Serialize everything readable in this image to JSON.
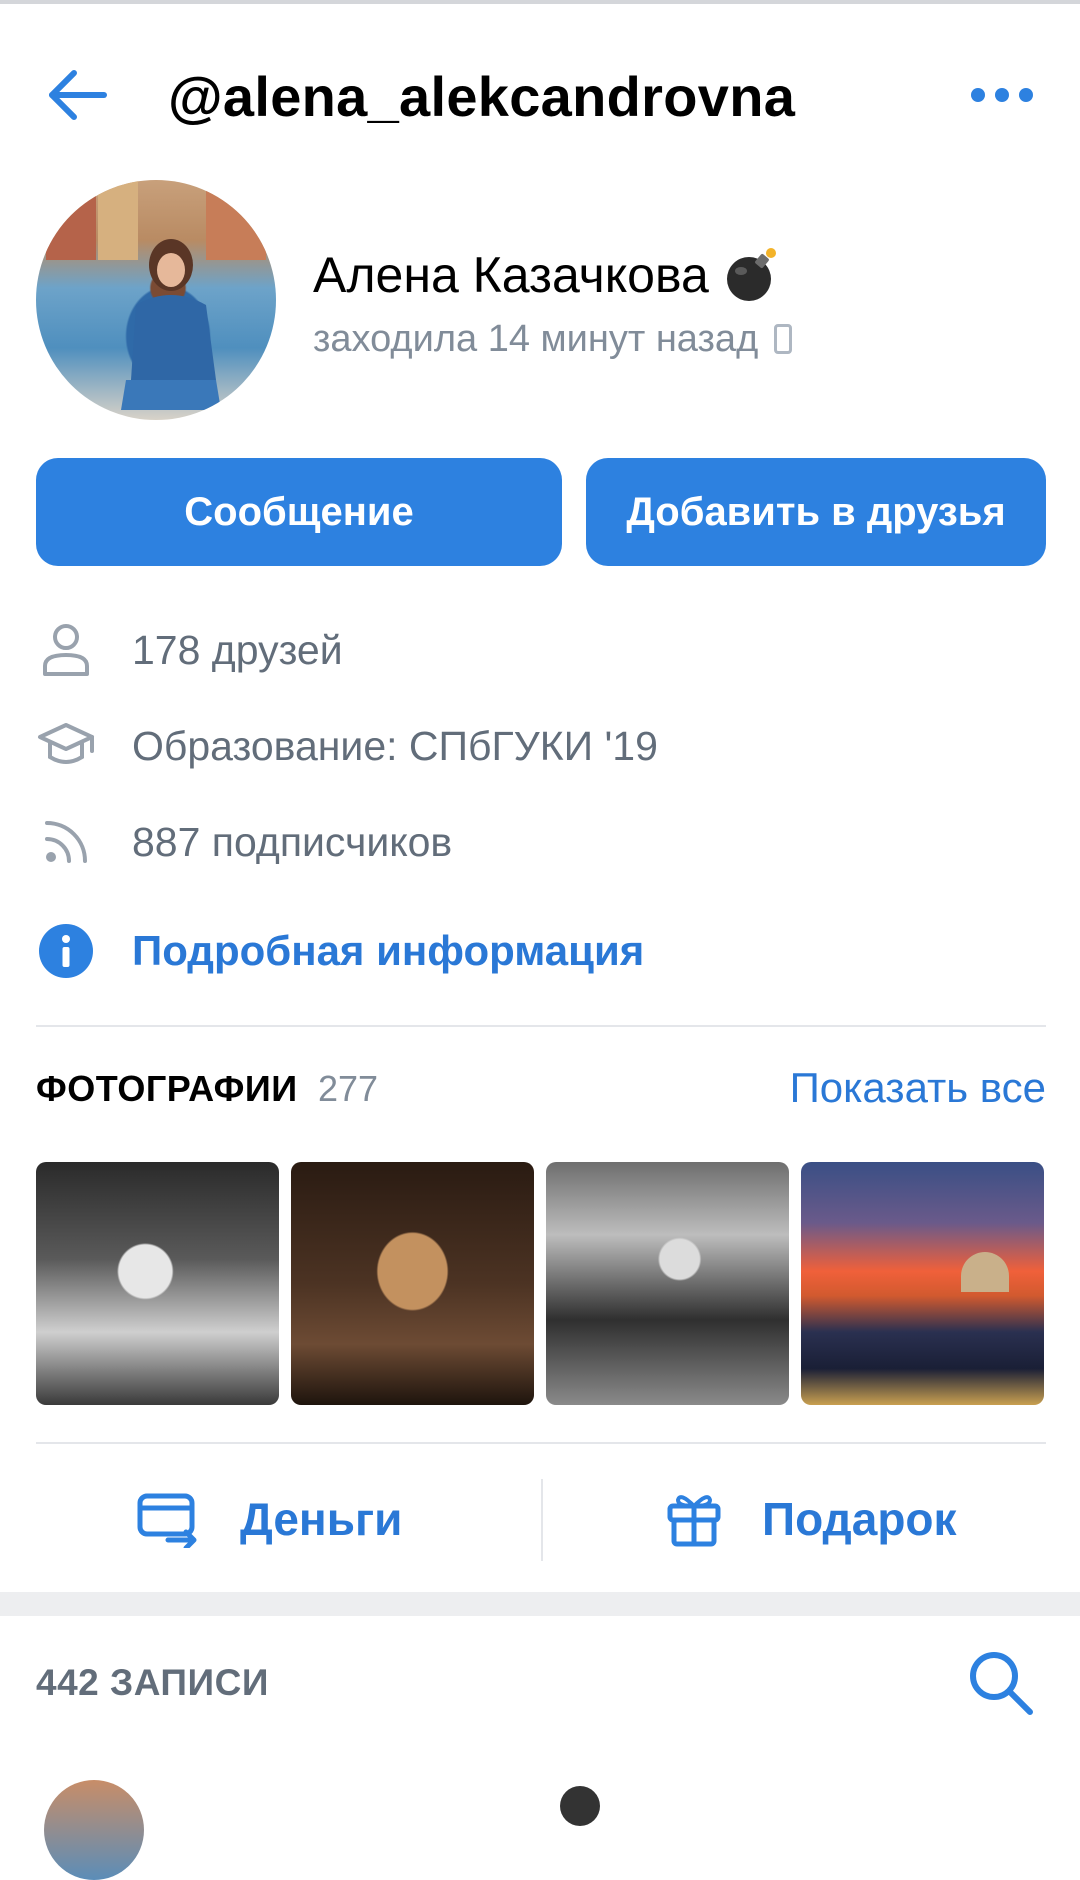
{
  "header": {
    "handle": "@alena_alekcandrovna",
    "back_icon": "arrow-left-icon",
    "more_icon": "more-horizontal-icon"
  },
  "profile": {
    "name": "Алена Казачкова",
    "emoji": "bomb-emoji",
    "status": "заходила 14 минут назад",
    "status_device_icon": "phone-icon"
  },
  "buttons": {
    "message": "Сообщение",
    "add_friend": "Добавить в друзья"
  },
  "info": [
    {
      "icon": "user-icon",
      "text": "178 друзей"
    },
    {
      "icon": "graduation-cap-icon",
      "text": "Образование: СПбГУКИ '19"
    },
    {
      "icon": "rss-icon",
      "text": "887 подписчиков"
    }
  ],
  "details_link": {
    "icon": "info-icon",
    "text": "Подробная информация"
  },
  "photos": {
    "title": "ФОТОГРАФИИ",
    "count": "277",
    "show_all": "Показать все"
  },
  "actions": {
    "money": {
      "icon": "card-transfer-icon",
      "label": "Деньги"
    },
    "gift": {
      "icon": "gift-icon",
      "label": "Подарок"
    }
  },
  "posts": {
    "title": "442 ЗАПИСИ",
    "search_icon": "search-icon"
  },
  "colors": {
    "accent": "#2d81e0",
    "link": "#2a78d6",
    "secondary_text": "#818c99"
  }
}
